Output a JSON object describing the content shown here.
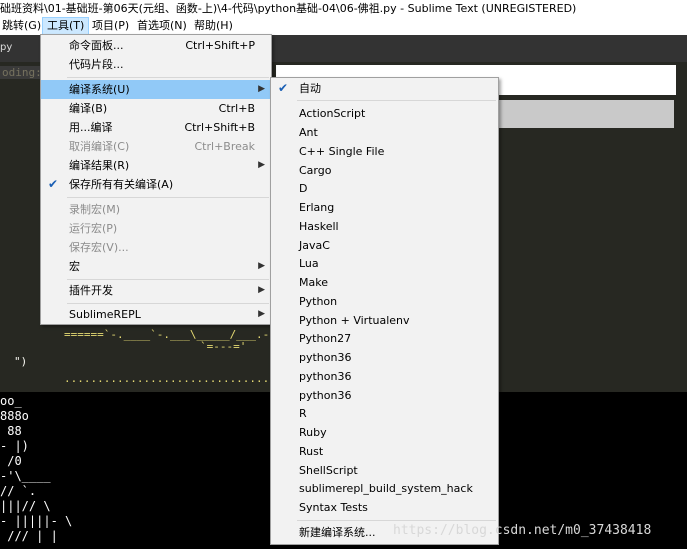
{
  "window": {
    "title": "础班资料\\01-基础班-第06天(元组、函数-上)\\4-代码\\python基础-04\\06-佛祖.py - Sublime Text (UNREGISTERED)"
  },
  "menubar": {
    "items": [
      {
        "label": "跳转(G)"
      },
      {
        "label": "工具(T)"
      },
      {
        "label": "项目(P)"
      },
      {
        "label": "首选项(N)"
      },
      {
        "label": "帮助(H)"
      }
    ]
  },
  "editor": {
    "tab_label": "py",
    "ghost_line": "oding:",
    "code_lines": [
      "======`-.____`-.___\\_____/___.-`____.-'======",
      "`=---='",
      "\")",
      "..................................."
    ]
  },
  "console": {
    "lines": [
      "oo_",
      "888o",
      " 88",
      "- |)",
      " /0",
      "-'\\____",
      "// `.",
      "|||// \\",
      "- |||||- \\",
      " /// | |"
    ]
  },
  "tools_menu": {
    "items": [
      {
        "label": "命令面板...",
        "shortcut": "Ctrl+Shift+P"
      },
      {
        "label": "代码片段..."
      },
      {
        "label": "编译系统(U)",
        "submenu": true,
        "highlighted": true
      },
      {
        "label": "编译(B)",
        "shortcut": "Ctrl+B"
      },
      {
        "label": "用...编译",
        "shortcut": "Ctrl+Shift+B"
      },
      {
        "label": "取消编译(C)",
        "shortcut": "Ctrl+Break",
        "disabled": true
      },
      {
        "label": "编译结果(R)",
        "submenu": true
      },
      {
        "label": "保存所有有关编译(A)",
        "checked": true
      },
      {
        "label": "录制宏(M)",
        "disabled": true
      },
      {
        "label": "运行宏(P)",
        "disabled": true
      },
      {
        "label": "保存宏(V)...",
        "disabled": true
      },
      {
        "label": "宏",
        "submenu": true
      },
      {
        "label": "插件开发",
        "submenu": true
      },
      {
        "label": "SublimeREPL",
        "submenu": true
      }
    ]
  },
  "build_menu": {
    "items": [
      {
        "label": "自动",
        "checked": true
      },
      {
        "label": "ActionScript"
      },
      {
        "label": "Ant"
      },
      {
        "label": "C++ Single File"
      },
      {
        "label": "Cargo"
      },
      {
        "label": "D"
      },
      {
        "label": "Erlang"
      },
      {
        "label": "Haskell"
      },
      {
        "label": "JavaC"
      },
      {
        "label": "Lua"
      },
      {
        "label": "Make"
      },
      {
        "label": "Python"
      },
      {
        "label": "Python + Virtualenv"
      },
      {
        "label": "Python27"
      },
      {
        "label": "python36"
      },
      {
        "label": "python36"
      },
      {
        "label": "python36"
      },
      {
        "label": "R"
      },
      {
        "label": "Ruby"
      },
      {
        "label": "Rust"
      },
      {
        "label": "ShellScript"
      },
      {
        "label": "sublimerepl_build_system_hack"
      },
      {
        "label": "Syntax Tests"
      },
      {
        "label": "新建编译系统..."
      }
    ]
  },
  "watermark": "https://blog.csdn.net/m0_37438418",
  "colors": {
    "menu_highlight": "#91c9f7",
    "editor_bg": "#272822",
    "console_bg": "#000000",
    "check_color": "#1a5fb4"
  }
}
